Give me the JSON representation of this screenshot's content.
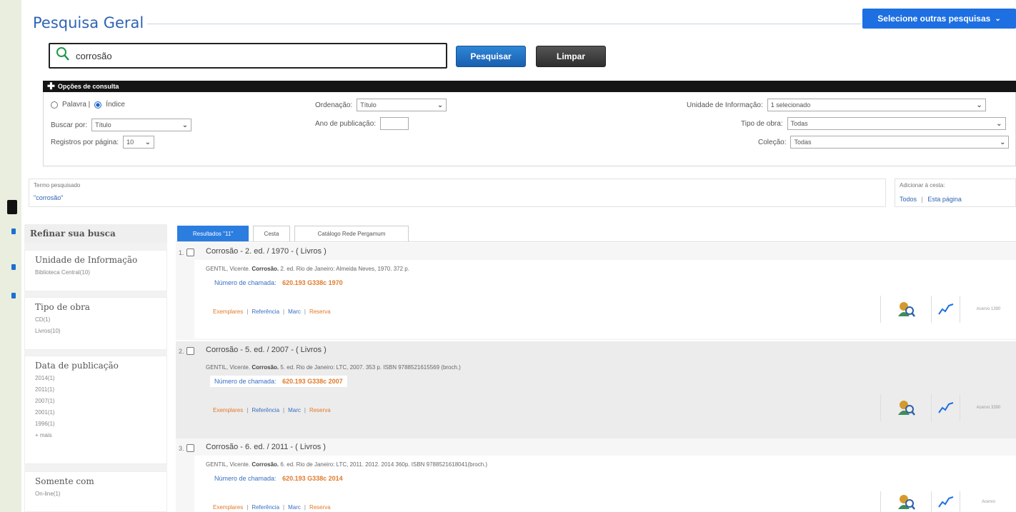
{
  "header": {
    "title": "Pesquisa Geral",
    "other_searches_label": "Selecione outras pesquisas"
  },
  "search": {
    "value": "corrosão",
    "search_button": "Pesquisar",
    "clear_button": "Limpar"
  },
  "options": {
    "bar_label": "Opções de consulta",
    "radio_palavra": "Palavra |",
    "radio_indice": "Índice",
    "buscar_por_label": "Buscar por:",
    "buscar_por_value": "Título",
    "registros_label": "Registros por página:",
    "registros_value": "10",
    "ordenacao_label": "Ordenação:",
    "ordenacao_value": "Título",
    "ano_label": "Ano de publicação:",
    "unidade_label": "Unidade de Informação:",
    "unidade_value": "1 selecionado",
    "tipo_obra_label": "Tipo de obra:",
    "tipo_obra_value": "Todas",
    "colecao_label": "Coleção:",
    "colecao_value": "Todas"
  },
  "term": {
    "label": "Termo pesquisado",
    "value": "\"corrosão\""
  },
  "cart": {
    "label": "Adicionar à cesta:",
    "todos": "Todos",
    "sep": "|",
    "esta_pagina": "Esta página"
  },
  "sidebar": {
    "head": "Refinar sua busca",
    "facets": [
      {
        "title": "Unidade de Informação",
        "items": [
          "Biblioteca Central(10)"
        ]
      },
      {
        "title": "Tipo de obra",
        "items": [
          "CD(1)",
          "Livros(10)"
        ]
      },
      {
        "title": "Data de publicação",
        "items": [
          "2014(1)",
          "2011(1)",
          "2007(1)",
          "2001(1)",
          "1996(1)",
          "+ mais"
        ]
      },
      {
        "title": "Somente com",
        "items": [
          "On-line(1)"
        ]
      }
    ]
  },
  "tabs": [
    "Resultados \"11\"",
    "Cesta",
    "Catálogo Rede Pergamum"
  ],
  "results": [
    {
      "num": "1.",
      "title": "Corrosão - 2. ed. / 1970 - ( Livros )",
      "author": "GENTIL, Vicente.",
      "bold": "Corrosão.",
      "desc": " 2. ed. Rio de Janeiro: Almeida Neves, 1970. 372 p.",
      "call_label": "Número de chamada:",
      "call_code": "620.193 G338c 1970",
      "links": [
        "Exemplares",
        "Referência",
        "Marc",
        "Reserva"
      ],
      "acervo": "Acervo 1390"
    },
    {
      "num": "2.",
      "title": "Corrosão - 5. ed. / 2007 - ( Livros )",
      "author": "GENTIL, Vicente.",
      "bold": "Corrosão.",
      "desc": " 5. ed. Rio de Janeiro: LTC, 2007. 353 p. ISBN 9788521615569 (broch.)",
      "call_label": "Número de chamada:",
      "call_code": "620.193 G338c 2007",
      "links": [
        "Exemplares",
        "Referência",
        "Marc",
        "Reserva"
      ],
      "acervo": "Acervo 3390"
    },
    {
      "num": "3.",
      "title": "Corrosão - 6. ed. / 2011 - ( Livros )",
      "author": "GENTIL, Vicente.",
      "bold": "Corrosão.",
      "desc": " 6. ed. Rio de Janeiro: LTC, 2011. 2012. 2014 360p. ISBN 9788521618041(broch.)",
      "call_label": "Número de chamada:",
      "call_code": "620.193 G338c 2014",
      "links": [
        "Exemplares",
        "Referência",
        "Marc",
        "Reserva"
      ],
      "acervo": "Acervo"
    }
  ]
}
